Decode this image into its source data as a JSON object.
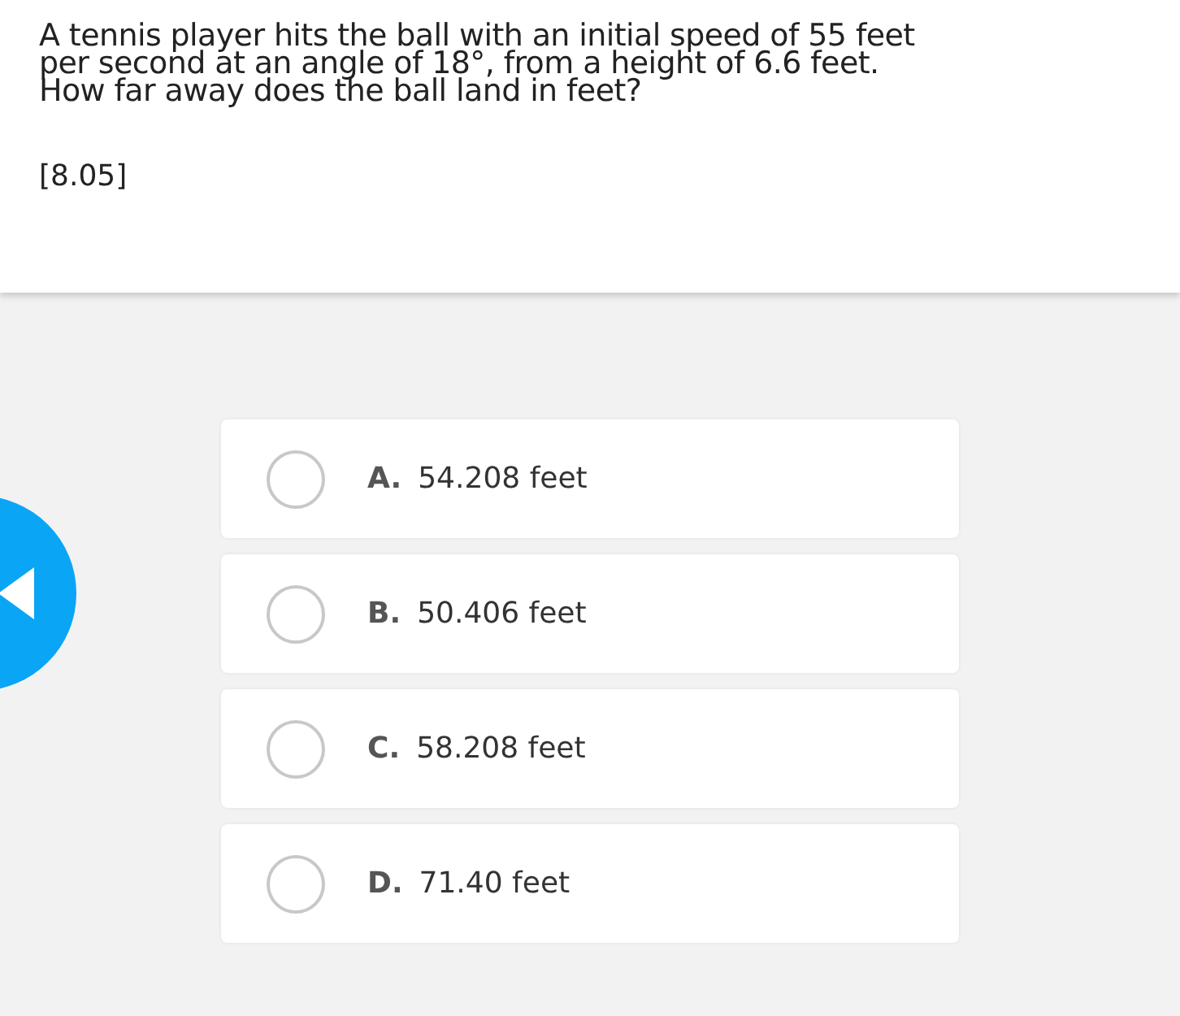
{
  "question": {
    "text": "A tennis player hits the ball with an initial speed of 55 feet per second at an angle of 18°, from a height of 6.6 feet. How far away does the ball land in feet?",
    "reference": "[8.05]"
  },
  "options": [
    {
      "letter": "A.",
      "text": "54.208 feet",
      "selected": false
    },
    {
      "letter": "B.",
      "text": "50.406 feet",
      "selected": false
    },
    {
      "letter": "C.",
      "text": "58.208 feet",
      "selected": false
    },
    {
      "letter": "D.",
      "text": "71.40 feet",
      "selected": false
    }
  ]
}
